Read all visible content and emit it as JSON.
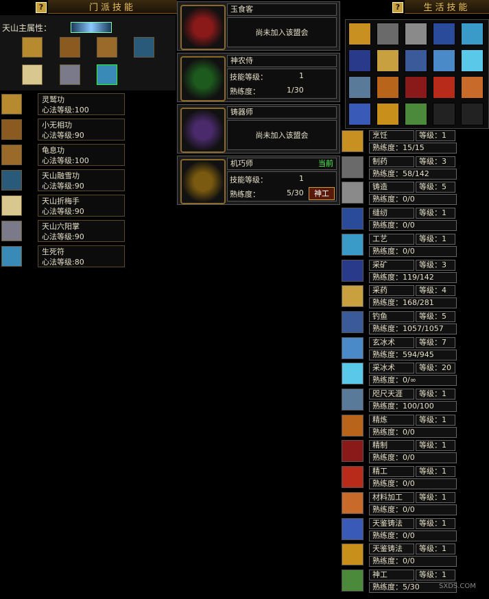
{
  "sect_panel": {
    "title": "门派技能",
    "help": "?",
    "main_attr_label": "天山主属性："
  },
  "sect_skills": [
    {
      "name": "灵鹫功",
      "level_text": "心法等级:100",
      "icon": "scroll-icon"
    },
    {
      "name": "小无相功",
      "level_text": "心法等级:90",
      "icon": "book-icon"
    },
    {
      "name": "龟息功",
      "level_text": "心法等级:100",
      "icon": "book-icon"
    },
    {
      "name": "天山融雪功",
      "level_text": "心法等级:90",
      "icon": "ice-book-icon"
    },
    {
      "name": "天山折梅手",
      "level_text": "心法等级:90",
      "icon": "plum-scroll-icon"
    },
    {
      "name": "天山六阳掌",
      "level_text": "心法等级:90",
      "icon": "palm-book-icon"
    },
    {
      "name": "生死符",
      "level_text": "心法等级:80",
      "icon": "talisman-icon"
    }
  ],
  "guilds": [
    {
      "name": "玉食客",
      "status": "尚未加入该盟会",
      "joined": false,
      "color": "#8a1a1a"
    },
    {
      "name": "神农侍",
      "skill_label": "技能等级：",
      "skill_value": "1",
      "prof_label": "熟练度：",
      "prof_value": "1/30",
      "joined": true,
      "color": "#1d5a1d"
    },
    {
      "name": "铸器师",
      "status": "尚未加入该盟会",
      "joined": false,
      "color": "#4a2a6a"
    },
    {
      "name": "机巧师",
      "current": "当前",
      "skill_label": "技能等级：",
      "skill_value": "1",
      "prof_label": "熟练度：",
      "prof_value": "5/30",
      "button": "神工",
      "joined": true,
      "color": "#7a5a10"
    }
  ],
  "life_panel": {
    "title": "生活技能",
    "help": "?"
  },
  "life_skills": [
    {
      "name": "烹饪",
      "level": "等级：1",
      "prof": "熟练度：15/15"
    },
    {
      "name": "制药",
      "level": "等级：3",
      "prof": "熟练度：58/142"
    },
    {
      "name": "铸造",
      "level": "等级：5",
      "prof": "熟练度：0/0"
    },
    {
      "name": "缝纫",
      "level": "等级：1",
      "prof": "熟练度：0/0"
    },
    {
      "name": "工艺",
      "level": "等级：1",
      "prof": "熟练度：0/0"
    },
    {
      "name": "采矿",
      "level": "等级：3",
      "prof": "熟练度：119/142"
    },
    {
      "name": "采药",
      "level": "等级：4",
      "prof": "熟练度：168/281"
    },
    {
      "name": "钓鱼",
      "level": "等级：5",
      "prof": "熟练度：1057/1057"
    },
    {
      "name": "玄冰术",
      "level": "等级：7",
      "prof": "熟练度：594/945"
    },
    {
      "name": "采冰术",
      "level": "等级：20",
      "prof": "熟练度：0/∞"
    },
    {
      "name": "咫尺天涯",
      "level": "等级：1",
      "prof": "熟练度：100/100"
    },
    {
      "name": "精炼",
      "level": "等级：1",
      "prof": "熟练度：0/0"
    },
    {
      "name": "精制",
      "level": "等级：1",
      "prof": "熟练度：0/0"
    },
    {
      "name": "精工",
      "level": "等级：1",
      "prof": "熟练度：0/0"
    },
    {
      "name": "材料加工",
      "level": "等级：1",
      "prof": "熟练度：0/0"
    },
    {
      "name": "天鉴铸法",
      "level": "等级：1",
      "prof": "熟练度：0/0"
    },
    {
      "name": "天鉴铸法",
      "level": "等级：1",
      "prof": "熟练度：0/0"
    },
    {
      "name": "神工",
      "level": "等级：1",
      "prof": "熟练度：5/30"
    }
  ],
  "watermark": "SXDS.COM",
  "colors": {
    "gold": "#e8c060",
    "panel_bg": "#141414",
    "border": "#666666"
  }
}
